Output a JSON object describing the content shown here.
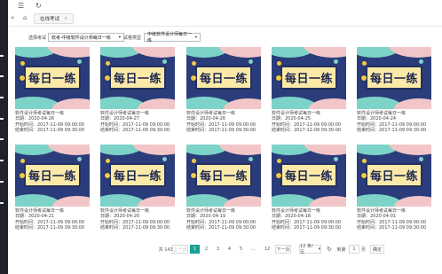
{
  "topbar": {
    "menu_icon": "☰",
    "refresh_icon": "↻"
  },
  "tabbar": {
    "collapse_icon": "«",
    "home_icon": "⌂",
    "tab_label": "在线考试",
    "tab_close": "×"
  },
  "filters": {
    "exam_label": "选择考试",
    "exam_value": "软考-中级软件设计师每日一练",
    "type_label": "试卷类型",
    "type_value": "中级软件设计师每日一练"
  },
  "cards": [
    {
      "banner": "每日一练",
      "title": "软件设计师考试每日一练",
      "date": "日期：2020-04-26",
      "start": "开始时间：2017-11-09 09:00:00",
      "end": "结束时间：2017-11-09 09:30:00"
    },
    {
      "banner": "每日一练",
      "title": "软件设计师考试每日一练",
      "date": "日期：2020-04-27",
      "start": "开始时间：2017-11-09 09:00:00",
      "end": "结束时间：2017-11-09 09:30:00"
    },
    {
      "banner": "每日一练",
      "title": "软件设计师考试每日一练",
      "date": "日期：2020-04-26",
      "start": "开始时间：2017-11-09 09:00:00",
      "end": "结束时间：2017-11-09 09:30:00"
    },
    {
      "banner": "每日一练",
      "title": "软件设计师考试每日一练",
      "date": "日期：2020-04-25",
      "start": "开始时间：2017-11-09 09:00:00",
      "end": "结束时间：2017-11-09 09:30:00"
    },
    {
      "banner": "每日一练",
      "title": "软件设计师考试每日一练",
      "date": "日期：2020-04-24",
      "start": "开始时间：2017-11-09 09:00:00",
      "end": "结束时间：2017-11-09 09:30:00"
    },
    {
      "banner": "每日一练",
      "title": "软件设计师考试每日一练",
      "date": "日期：2020-04-21",
      "start": "开始时间：2017-11-09 09:00:00",
      "end": "结束时间：2017-11-09 09:30:00"
    },
    {
      "banner": "每日一练",
      "title": "软件设计师考试每日一练",
      "date": "日期：2020-04-20",
      "start": "开始时间：2017-11-09 09:00:00",
      "end": "结束时间：2017-11-09 09:30:00"
    },
    {
      "banner": "每日一练",
      "title": "软件设计师考试每日一练",
      "date": "日期：2020-04-19",
      "start": "开始时间：2017-11-09 09:00:00",
      "end": "结束时间：2017-11-09 09:30:00"
    },
    {
      "banner": "每日一练",
      "title": "软件设计师考试每日一练",
      "date": "日期：2020-04-18",
      "start": "开始时间：2017-11-09 09:00:00",
      "end": "结束时间：2017-11-09 09:30:00"
    },
    {
      "banner": "每日一练",
      "title": "软件设计师考试每日一练",
      "date": "日期：2020-04-01",
      "start": "开始时间：2017-11-09 09:00:00",
      "end": "结束时间：2017-11-09 09:30:00"
    }
  ],
  "pagination": {
    "total": "共 143 条",
    "prev": "上一页",
    "pages": [
      "1",
      "2",
      "3",
      "4",
      "5",
      "…",
      "12"
    ],
    "next": "下一页",
    "page_size": "12 条/页",
    "refresh_icon": "↻",
    "goto_label": "到第",
    "goto_value": "1",
    "page_unit": "页",
    "confirm": "确定"
  },
  "colors": {
    "accent": "#1aa094",
    "card_bg": "#2a3d7a",
    "banner_bg": "#fbe9a8",
    "sidebar": "#1f2329"
  }
}
